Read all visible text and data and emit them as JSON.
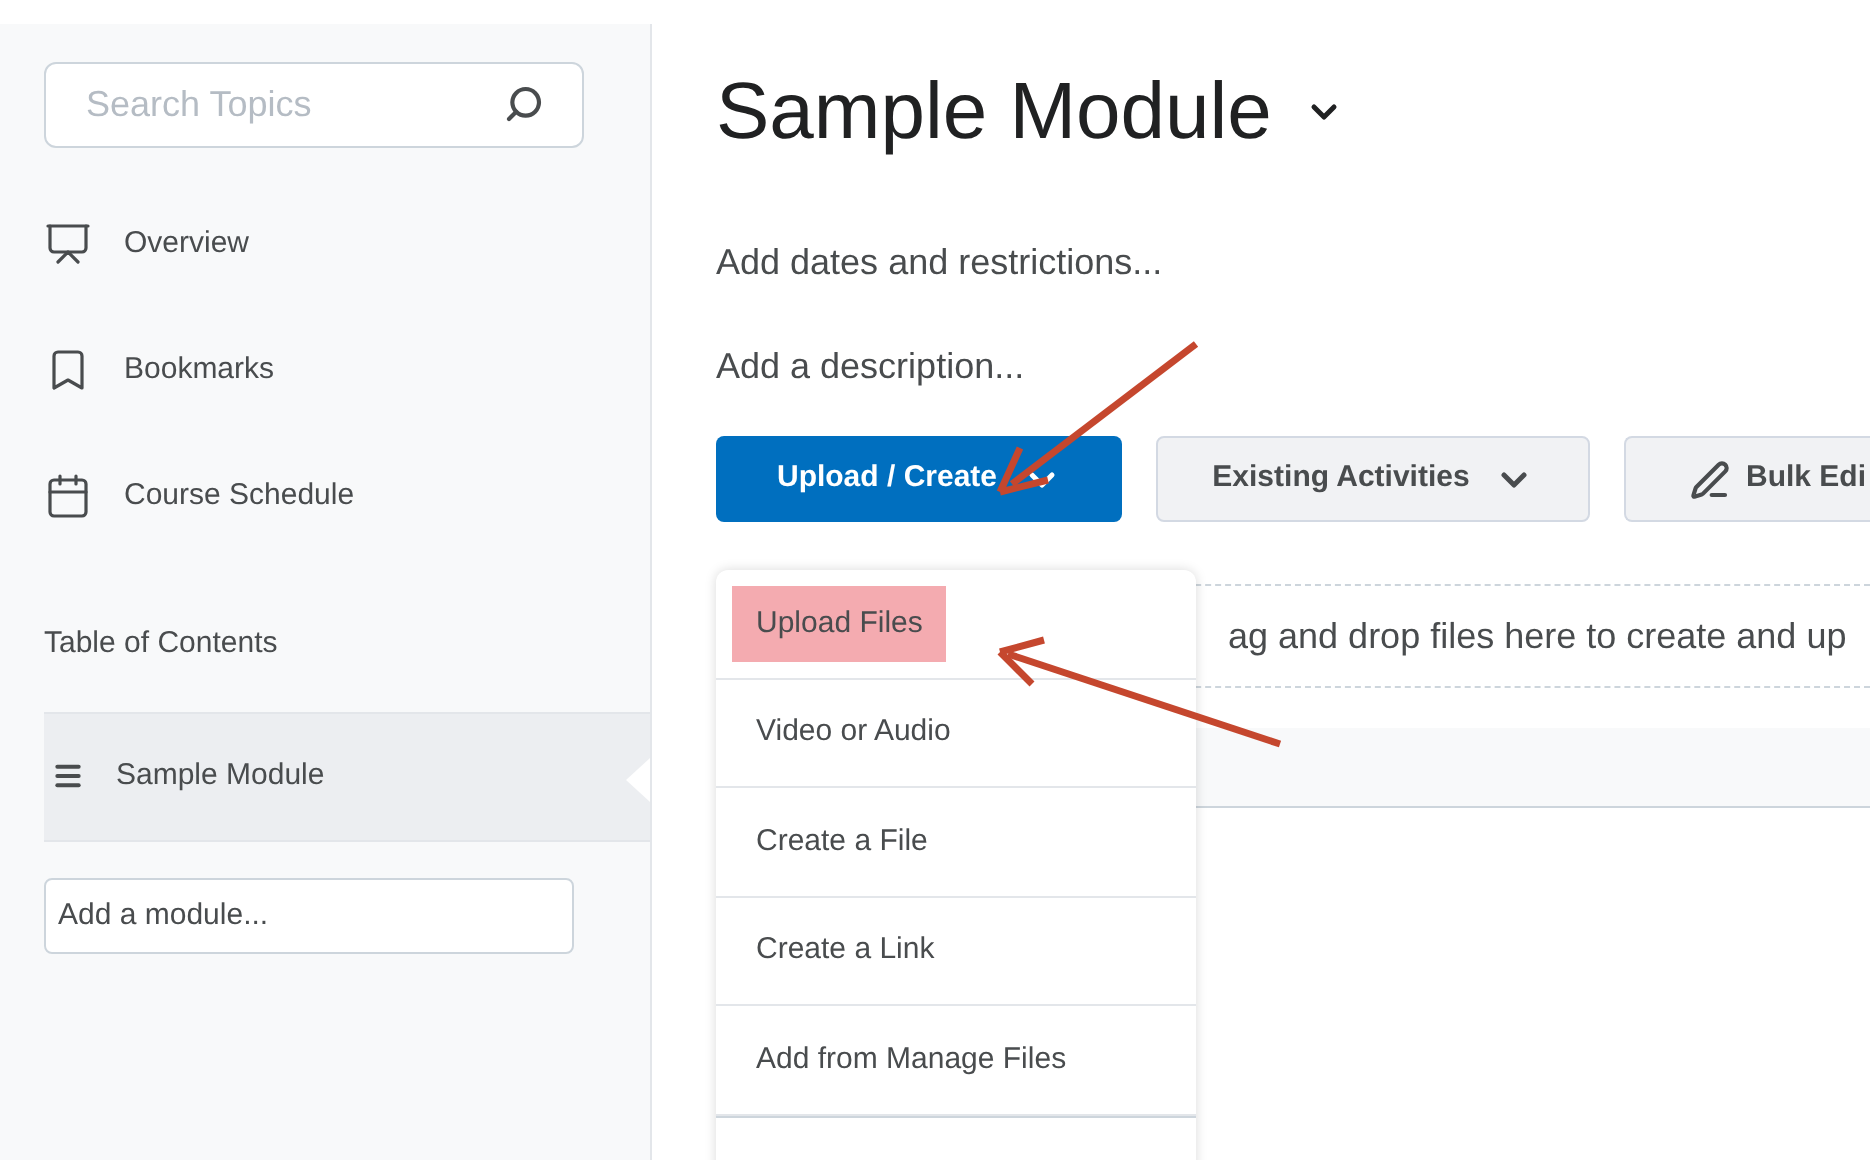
{
  "sidebar": {
    "search": {
      "placeholder": "Search Topics"
    },
    "nav": [
      {
        "label": "Overview",
        "kind": "presentation"
      },
      {
        "label": "Bookmarks",
        "kind": "bookmark"
      },
      {
        "label": "Course Schedule",
        "kind": "calendar"
      }
    ],
    "toc_heading": "Table of Contents",
    "modules": [
      {
        "label": "Sample Module",
        "selected": true
      }
    ],
    "add_module": {
      "placeholder": "Add a module..."
    }
  },
  "main": {
    "title": "Sample Module",
    "links": [
      "Add dates and restrictions...",
      "Add a description..."
    ],
    "buttons": [
      {
        "label": "Upload / Create",
        "kind": "primary"
      },
      {
        "label": "Existing Activities",
        "kind": "dropdown"
      },
      {
        "label": "Bulk Edi",
        "kind": "edit"
      }
    ],
    "drop_zone": "ag and drop files here to create and up",
    "menu": [
      {
        "label": "Upload Files",
        "highlighted": true
      },
      {
        "label": "Video or Audio",
        "highlighted": false
      },
      {
        "label": "Create a File",
        "highlighted": false
      },
      {
        "label": "Create a Link",
        "highlighted": false
      },
      {
        "label": "Add from Manage Files",
        "highlighted": false
      }
    ]
  }
}
